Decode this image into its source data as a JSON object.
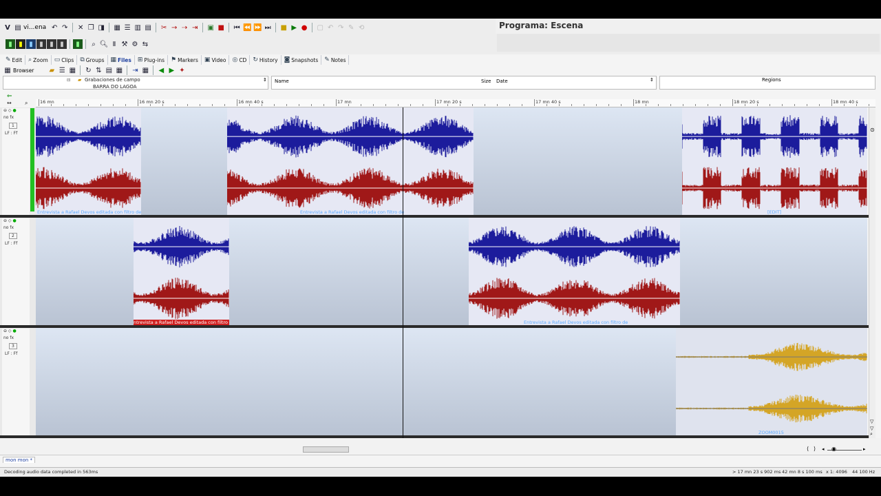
{
  "app": {
    "title_fragment": "V",
    "doc_fragment": "vi...ena",
    "program_label": "Programa: Escena"
  },
  "nav_tabs": [
    {
      "label": "Edit",
      "icon": "pencil-icon"
    },
    {
      "label": "Zoom",
      "icon": "magnifier-icon"
    },
    {
      "label": "Clips",
      "icon": "clip-icon"
    },
    {
      "label": "Groups",
      "icon": "groups-icon"
    },
    {
      "label": "Files",
      "icon": "files-icon",
      "active": true
    },
    {
      "label": "Plug-ins",
      "icon": "plugin-icon"
    },
    {
      "label": "Markers",
      "icon": "marker-icon"
    },
    {
      "label": "Video",
      "icon": "film-icon"
    },
    {
      "label": "CD",
      "icon": "cd-icon"
    },
    {
      "label": "History",
      "icon": "history-icon"
    },
    {
      "label": "Snapshots",
      "icon": "camera-icon"
    },
    {
      "label": "Notes",
      "icon": "notes-icon"
    }
  ],
  "browser": {
    "label": "Browser",
    "tree": [
      "Grabaciones de campo",
      "BARRA DO LAGOA"
    ],
    "columns": {
      "name": "Name",
      "size": "Size",
      "date": "Date",
      "regions": "Regions"
    }
  },
  "ruler": {
    "labels": [
      "16 mn",
      "16 mn 20 s",
      "16 mn 40 s",
      "17 mn",
      "17 mn 20 s",
      "17 mn 40 s",
      "18 mn",
      "18 mn 20 s",
      "18 mn 40 s"
    ]
  },
  "tracks": [
    {
      "number": "1",
      "fx": "no fx",
      "gain": "LF : Ff"
    },
    {
      "number": "2",
      "fx": "no fx",
      "gain": "LF : Ff"
    },
    {
      "number": "3",
      "fx": "no fx",
      "gain": "LF : Ff"
    }
  ],
  "clips": {
    "track1_clip1": "Entrevista a Rafael Devos editada con filtro de",
    "track1_clip2": "Entrevista a Rafael Devos editada con filtro de",
    "track1_clip3": "[EDIT]",
    "track2_clip1": "ntrevista a Rafael Devos editada con filtro d",
    "track2_clip2": "Entrevista a Rafael Devos editada con filtro de",
    "track3_clip1": "ZOOM0015"
  },
  "bottom_tab": "mon mon *",
  "status": {
    "message": "Decoding audio data completed in 563ms",
    "position": "> 17 mn 23 s 902 ms",
    "length": "42 mn 8 s 100 ms",
    "zoom": "x 1: 4096",
    "rate": "44 100 Hz"
  },
  "colors": {
    "wave_left": "#1c1c9c",
    "wave_right": "#a01818",
    "wave_gold": "#d4a526",
    "lane_bg": "#cfd8e7",
    "accent_green": "#22c022"
  }
}
